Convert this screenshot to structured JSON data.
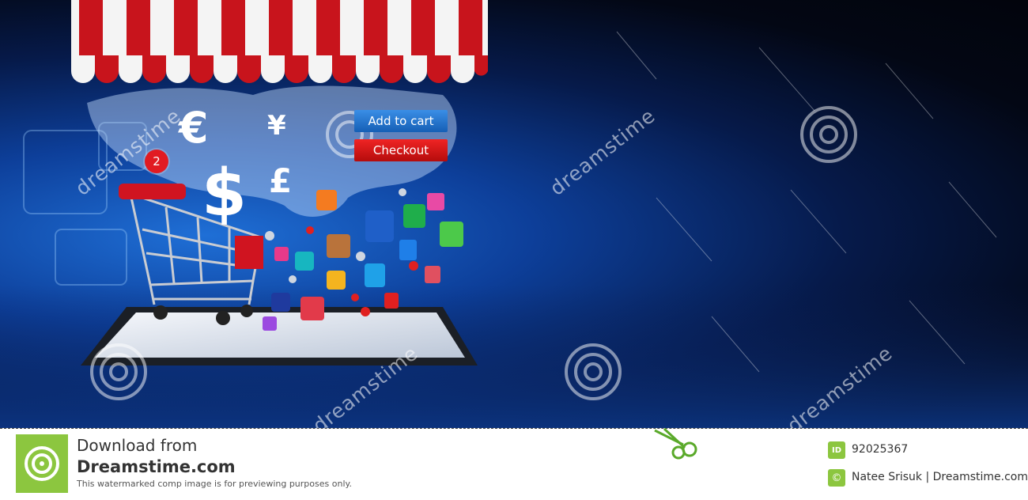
{
  "hero": {
    "add_to_cart_label": "Add to cart",
    "checkout_label": "Checkout",
    "cart_badge_count": "2",
    "currency_symbols": [
      "€",
      "¥",
      "$",
      "£"
    ],
    "watermark_text": "dreamstime",
    "colors": {
      "awning_red": "#c8141c",
      "awning_white": "#f4f4f4",
      "cart_button": "#1f76d2",
      "checkout_button": "#d61414"
    }
  },
  "footer": {
    "line1": "Download from",
    "line2": "Dreamstime.com",
    "line3": "This watermarked comp image is for previewing purposes only.",
    "id_label": "ID",
    "image_id": "92025367",
    "copyright_symbol": "©",
    "author": "Natee Srisuk | Dreamstime.com",
    "brand_color": "#8cc63f"
  }
}
